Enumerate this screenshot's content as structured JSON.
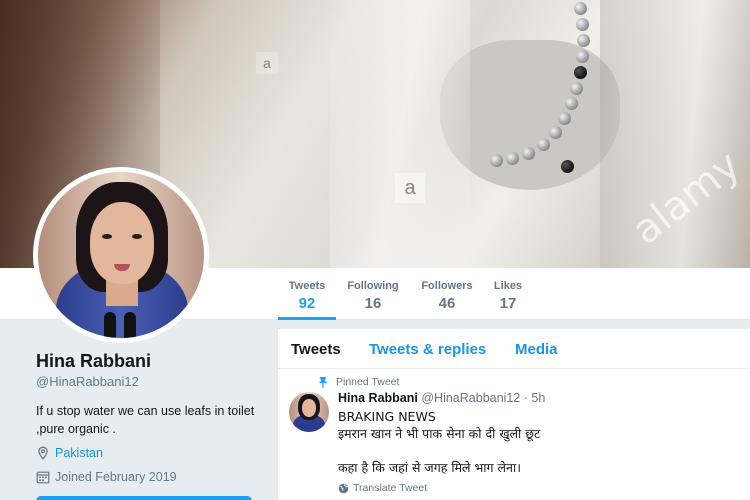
{
  "header": {
    "watermark_small": "a",
    "watermark_brand": "alamy"
  },
  "profile_nav": {
    "items": [
      {
        "label": "Tweets",
        "value": "92"
      },
      {
        "label": "Following",
        "value": "16"
      },
      {
        "label": "Followers",
        "value": "46"
      },
      {
        "label": "Likes",
        "value": "17"
      }
    ],
    "active": "Tweets"
  },
  "profile": {
    "name": "Hina Rabbani",
    "handle": "@HinaRabbani12",
    "bio_lines": [
      "If u stop water we can use leafs in toilet",
      ",pure organic ."
    ],
    "location": "Pakistan",
    "joined": "Joined February 2019"
  },
  "timeline": {
    "tabs": [
      "Tweets",
      "Tweets & replies",
      "Media"
    ],
    "pinned_tweet": {
      "context_label": "Pinned Tweet",
      "author_name": "Hina Rabbani",
      "author_handle": "@HinaRabbani12",
      "separator": "·",
      "time": "5h",
      "lines": [
        "BRAKING NEWS",
        "इमरान खान ने भी पाक सेना को दी खुली छूट",
        "",
        "कहा है कि जहां से जगह मिले भाग लेना।"
      ],
      "translate_label": "Translate Tweet"
    }
  },
  "icons": {
    "location": "location-pin-icon",
    "calendar": "calendar-icon",
    "pin": "pin-icon",
    "globe": "globe-icon"
  },
  "colors": {
    "accent": "#1da1f2",
    "link": "#1b95e0",
    "muted": "#657786",
    "text": "#14171a",
    "background": "#e6ecf0"
  }
}
